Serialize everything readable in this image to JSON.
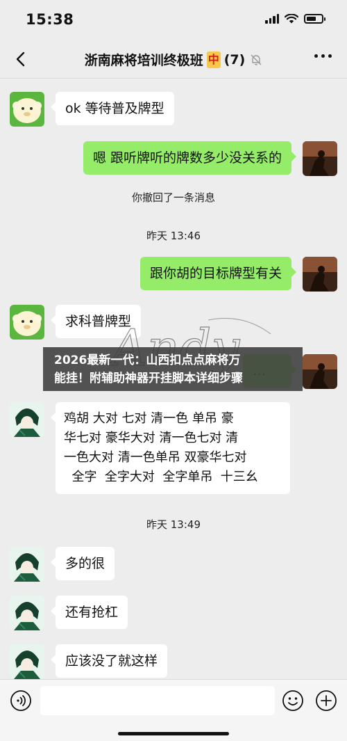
{
  "status_bar": {
    "time": "15:38"
  },
  "nav": {
    "title": "浙南麻将培训终极班",
    "tile_char": "中",
    "member_count": "(7)",
    "icons": [
      "back-icon",
      "mute-bell-icon",
      "more-icon"
    ]
  },
  "messages": [
    {
      "side": "left",
      "avatar": "sheep",
      "text": "ok 等待普及牌型"
    },
    {
      "side": "right",
      "text": "嗯 跟听牌听的牌数多少没关系的"
    },
    {
      "system": "你撤回了一条消息"
    },
    {
      "system": "昨天 13:46"
    },
    {
      "side": "right",
      "text": "跟你胡的目标牌型有关"
    },
    {
      "side": "left",
      "avatar": "sheep",
      "text": "求科普牌型"
    },
    {
      "side": "right",
      "text": "…"
    },
    {
      "side": "left",
      "avatar": "anime",
      "lines": [
        "鸡胡  大对  七对  清一色  单吊   豪",
        "华七对  豪华大对  清一色七对   清",
        "一色大对  清一色单吊  双豪华七对",
        "  全字  全字大对  全字单吊  十三幺"
      ]
    },
    {
      "system": "昨天 13:49"
    },
    {
      "side": "left",
      "avatar": "anime",
      "text": "多的很"
    },
    {
      "side": "left",
      "avatar": "anime",
      "text": "还有抢杠"
    },
    {
      "side": "left",
      "avatar": "anime",
      "text": "应该没了就这样"
    }
  ],
  "watermark": {
    "script_text": "Andy",
    "banner_lines": [
      "2026最新一代：山西扣点点麻将万",
      "能挂！附辅助神器开挂脚本详细步骤"
    ]
  },
  "input_bar": {
    "icons": [
      "voice-icon",
      "emoji-icon",
      "plus-icon"
    ]
  },
  "colors": {
    "bubble_self": "#95ec69",
    "bubble_other": "#ffffff",
    "background": "#ededed"
  }
}
